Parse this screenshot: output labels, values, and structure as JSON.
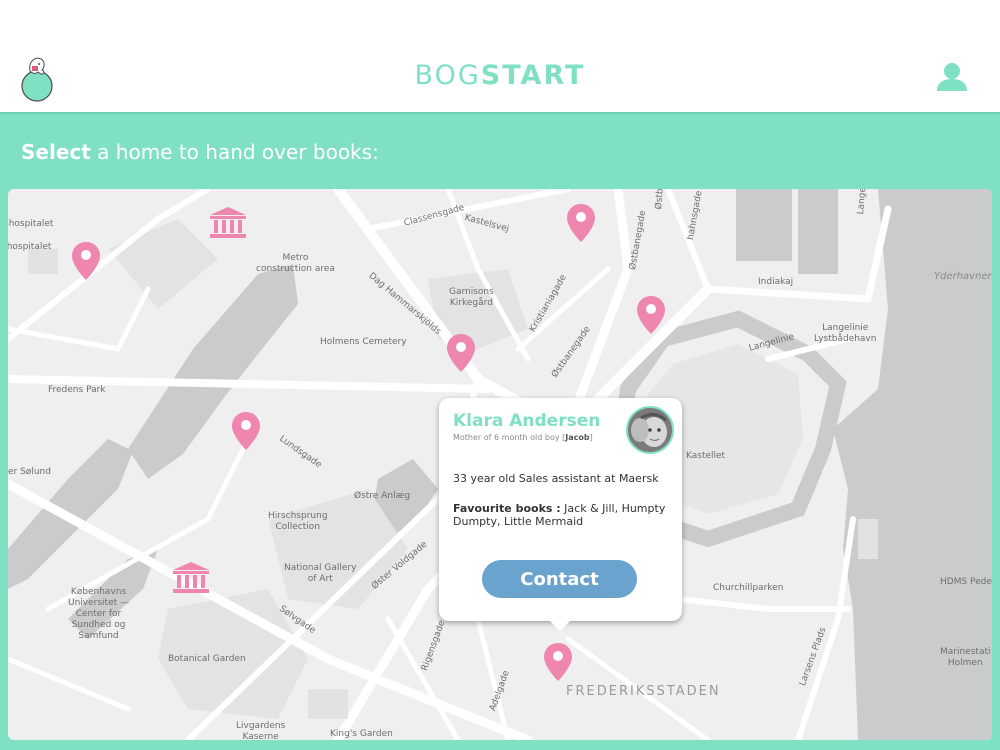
{
  "header": {
    "title_light": "BOG",
    "title_bold": "START",
    "logo_icon": "elephant-on-ball-logo",
    "user_icon": "user-icon"
  },
  "prompt": {
    "bold": "Select",
    "rest": " a home to hand over books:"
  },
  "map": {
    "labels": {
      "hospital1": "shospitalet",
      "hospital2": "shospitalet",
      "metro": "Metro\nconstruction area",
      "garnisons": "Garnisons\nKirkegård",
      "holmens": "Holmens Cemetery",
      "fredens": "Fredens Park",
      "soelund": "er Sølund",
      "hirschsprung": "Hirschsprung\nCollection",
      "national_gallery": "National Gallery\nof Art",
      "kobenhavns": "Københavns\nUniversitet —\nCenter for\nSundhed og\nSamfund",
      "botanical": "Botanical Garden",
      "livgardens": "Livgardens\nKaserne",
      "kings": "King's Garden",
      "kastellet": "Kastellet",
      "churchill": "Churchillparken",
      "langelinie": "Langelinie\nLystbådehavn",
      "yderhavnen": "Yderhavnen",
      "hdms": "HDMS Pede",
      "marinestation": "Marinestati\nHolmen",
      "frederiksstaden": "FREDERIKSSTADEN",
      "classensgade": "Classensgade",
      "kastelsvej": "Kastelsvej",
      "dag": "Dag Hammarskjölds",
      "kristianiagade": "Kristianiagade",
      "ostbanegade": "Østbanegade",
      "ostbanegade2": "Østbanegade",
      "hahnsgade": "hahnsgade",
      "indiakaj": "Indiakaj",
      "langelinie_road": "Langelinie",
      "lundsgade": "Lundsgade",
      "ostre_anlaeg": "Østre Anlæg",
      "oster_voldgade": "Øster Voldgade",
      "solvgade": "Sølvgade",
      "rigensgade": "Rigensgade",
      "adelgade": "Adelgade",
      "larsens": "Larsens Plads",
      "langelinie_top": "Lange",
      "ostbanegade_top": "Østbanegade"
    }
  },
  "popup": {
    "name": "Klara Andersen",
    "sub_prefix": "Mother of 6 month old boy [",
    "sub_child": "Jacob",
    "sub_suffix": "]",
    "occupation": "33 year old Sales assistant at Maersk",
    "fav_label": "Favourite books :",
    "fav_books": " Jack & Jill, Humpty Dumpty, Little Mermaid",
    "contact_label": "Contact"
  },
  "colors": {
    "accent": "#7fe0c4",
    "pin": "#ef86b0",
    "button": "#6aa3ce",
    "water": "#c9cbcd",
    "park": "#e3e3e3"
  }
}
